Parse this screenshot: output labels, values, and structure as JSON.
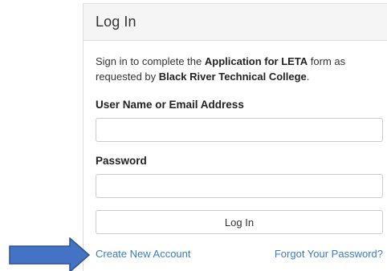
{
  "panel": {
    "title": "Log In"
  },
  "intro": {
    "prefix": "Sign in to complete the ",
    "form_name": "Application for LETA",
    "middle": " form as requested by ",
    "organization": "Black River Technical College",
    "suffix": "."
  },
  "username": {
    "label": "User Name or Email Address",
    "value": "",
    "placeholder": ""
  },
  "password": {
    "label": "Password",
    "value": "",
    "placeholder": ""
  },
  "login_button": {
    "label": "Log In"
  },
  "links": {
    "create_account": "Create New Account",
    "forgot_password": "Forgot Your Password?"
  },
  "colors": {
    "link": "#3a7bbf",
    "arrow_fill": "#4472c4",
    "arrow_stroke": "#2f528f",
    "header_bg": "#f5f5f5"
  },
  "annotation": {
    "arrow_icon": "right-arrow-icon"
  }
}
